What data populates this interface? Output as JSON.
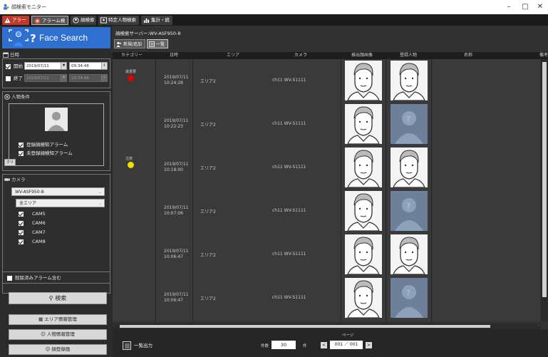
{
  "window": {
    "title": "顔検索モニター",
    "minimize": "–",
    "maximize": "□",
    "close": "✕"
  },
  "top_tabs": [
    {
      "label": "アラーム"
    },
    {
      "label": "アラーム検索"
    },
    {
      "label": "顔検索"
    },
    {
      "label": "特定人物検索"
    },
    {
      "label": "集計・統計"
    }
  ],
  "banner": {
    "title": "Face Search"
  },
  "datetime": {
    "heading": "日時",
    "start_label": "開始",
    "start_date": "2019/07/11",
    "start_time": "09:34:48",
    "end_label": "終了",
    "end_date": "2019/07/11",
    "end_time": "10:34:48"
  },
  "person": {
    "heading": "人物条件",
    "registered_alarm": "登録顔検知アラーム",
    "unregistered_alarm": "未登録顔検知アラーム",
    "clear_label": "クリア"
  },
  "camera": {
    "heading": "カメラ",
    "server": "WV-ASF950-8",
    "area": "全エリア",
    "cams": [
      "CAM5",
      "CAM6",
      "CAM7",
      "CAM8"
    ]
  },
  "include_cleared": "削除済みアラーム含む",
  "buttons": {
    "search": "検索",
    "area_info": "エリア情報管理",
    "person_info": "人物情報管理",
    "face_register": "顔登録画"
  },
  "right": {
    "server_label": "顔検索サーバー:WV-ASF950-8",
    "subtab_new": "新規/追加",
    "subtab_list": "一覧"
  },
  "table": {
    "headers": [
      "カテゴリー",
      "日時",
      "エリア",
      "カメラ",
      "検出顔画像",
      "登録人物",
      "名称",
      "備考"
    ],
    "rows": [
      {
        "category": "最重要",
        "dot": "#e00000",
        "date": "2019/07/11",
        "time": "10:24:28",
        "area": "エリア2",
        "camera": "ch11 WV-S1111",
        "registered": "face"
      },
      {
        "category": "",
        "dot": "",
        "date": "2019/07/11",
        "time": "10:22:23",
        "area": "エリア2",
        "camera": "ch11 WV-S1111",
        "registered": "unknown"
      },
      {
        "category": "注意",
        "dot": "#f0e000",
        "date": "2019/07/11",
        "time": "10:18:00",
        "area": "エリア2",
        "camera": "ch11 WV-S1111",
        "registered": "face"
      },
      {
        "category": "",
        "dot": "",
        "date": "2019/07/11",
        "time": "10:07:06",
        "area": "エリア2",
        "camera": "ch11 WV-S1111",
        "registered": "unknown"
      },
      {
        "category": "",
        "dot": "",
        "date": "2019/07/11",
        "time": "10:06:47",
        "area": "エリア2",
        "camera": "ch11 WV-S1111",
        "registered": "face"
      },
      {
        "category": "",
        "dot": "",
        "date": "2019/07/11",
        "time": "10:06:47",
        "area": "エリア2",
        "camera": "ch11 WV-S1111",
        "registered": "unknown"
      }
    ]
  },
  "bottom": {
    "list_output": "一覧出力",
    "count_label": "件数",
    "count_value": "30",
    "count_unit": "件",
    "page_label": "ページ",
    "page_value": "001 ／ 001",
    "prev": "<",
    "next": ">"
  },
  "colors": {
    "alarm_tab": "#c03a2b",
    "banner": "#2f6fd0",
    "unknown_face": "#6d7f99"
  }
}
